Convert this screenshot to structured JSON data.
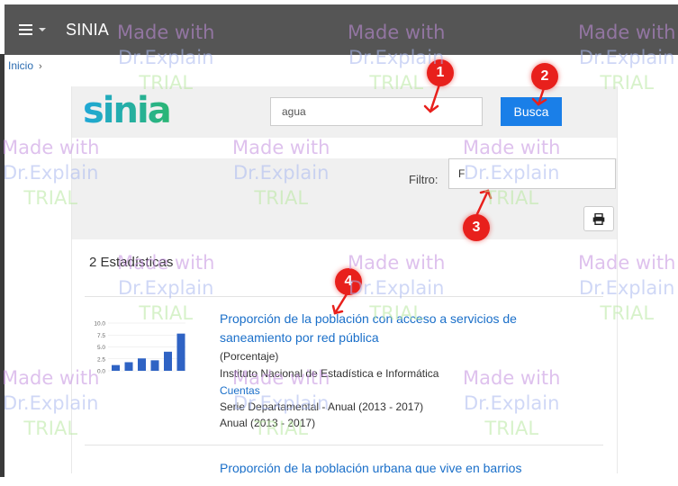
{
  "navbar": {
    "brand": "SINIA"
  },
  "breadcrumb": {
    "home": "Inicio",
    "separator": "›"
  },
  "logo": {
    "text": "sinia"
  },
  "search": {
    "value": "agua",
    "button_label": "Busca"
  },
  "filter": {
    "label": "Filtro:",
    "value": "F"
  },
  "results": {
    "count_label": "2 Estadísticas",
    "items": [
      {
        "title": "Proporción de la población con acceso a servicios de saneamiento por red pública",
        "subtitle": "(Porcentaje)",
        "source": "Instituto Nacional de Estadística e Informática",
        "source_link": "Cuentas",
        "periodicity": "Serie Departamental - Anual (2013 - 2017)",
        "years": "Anual (2013 - 2017)"
      },
      {
        "title": "Proporción de la población urbana que vive en barrios"
      }
    ],
    "thumb_chart": {
      "y_ticks": [
        "10.0",
        "7.5",
        "5.0",
        "2.5",
        "0.0"
      ],
      "bars": [
        1.2,
        1.8,
        2.6,
        2.2,
        4.0,
        7.8
      ]
    }
  },
  "callouts": [
    "1",
    "2",
    "3",
    "4"
  ],
  "watermark": {
    "line1": "Made with",
    "line2": "Dr.Explain",
    "line3": "TRIAL"
  },
  "colors": {
    "navbar": "#555555",
    "primary": "#1a7fe8",
    "link": "#1a6fc9",
    "callout": "#e8201c"
  },
  "icons": {
    "menu": "hamburger-icon",
    "print": "print-icon"
  }
}
